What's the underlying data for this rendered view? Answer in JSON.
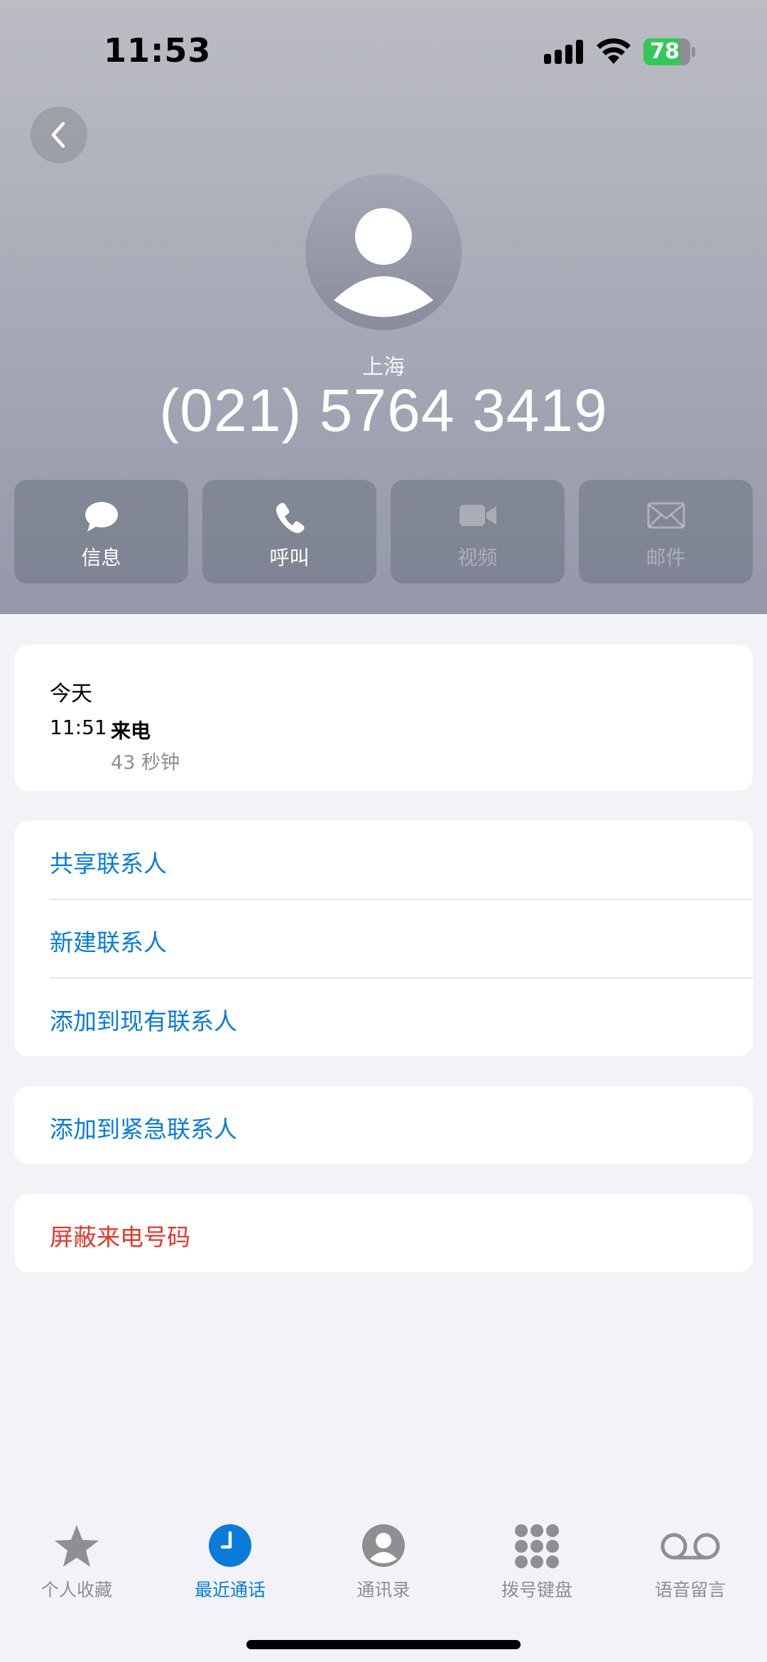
{
  "status_bar": {
    "time": "11:53",
    "battery_percent": 78,
    "battery_label": "78"
  },
  "contact": {
    "location": "上海",
    "phone_number": "(021) 5764 3419"
  },
  "actions": [
    {
      "label": "信息",
      "icon": "message-icon",
      "enabled": true
    },
    {
      "label": "呼叫",
      "icon": "phone-icon",
      "enabled": true
    },
    {
      "label": "视频",
      "icon": "video-icon",
      "enabled": false
    },
    {
      "label": "邮件",
      "icon": "mail-icon",
      "enabled": false
    }
  ],
  "recent": {
    "date": "今天",
    "time": "11:51",
    "type": "来电",
    "duration": "43 秒钟"
  },
  "contact_options": [
    "共享联系人",
    "新建联系人",
    "添加到现有联系人"
  ],
  "emergency": "添加到紧急联系人",
  "block": "屏蔽来电号码",
  "tabs": [
    {
      "label": "个人收藏",
      "icon": "star-icon",
      "active": false
    },
    {
      "label": "最近通话",
      "icon": "clock-icon",
      "active": true
    },
    {
      "label": "通讯录",
      "icon": "contacts-icon",
      "active": false
    },
    {
      "label": "拨号键盘",
      "icon": "keypad-icon",
      "active": false
    },
    {
      "label": "语音留言",
      "icon": "voicemail-icon",
      "active": false
    }
  ],
  "colors": {
    "accent": "#0a7bd8",
    "destructive": "#e5352b",
    "battery": "#34c759"
  }
}
